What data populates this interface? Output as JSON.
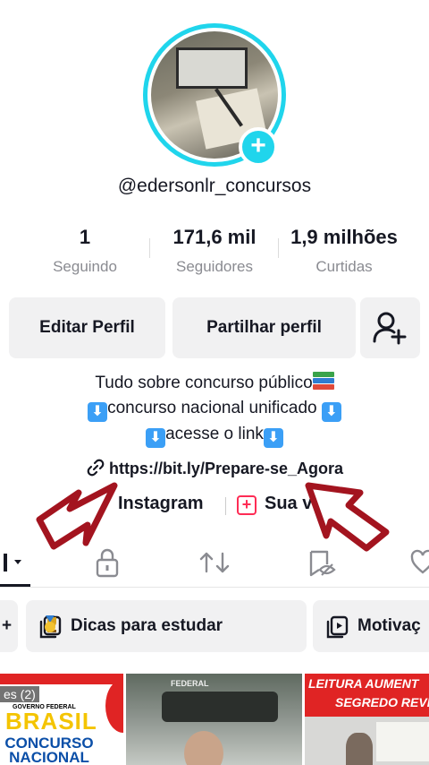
{
  "profile": {
    "username": "@edersonlr_concursos"
  },
  "stats": [
    {
      "value": "1",
      "label": "Seguindo"
    },
    {
      "value": "171,6 mil",
      "label": "Seguidores"
    },
    {
      "value": "1,9 milhões",
      "label": "Curtidas"
    }
  ],
  "actions": {
    "edit_label": "Editar Perfil",
    "share_label": "Partilhar perfil"
  },
  "bio": {
    "line1": "Tudo sobre concurso público",
    "line2": "concurso nacional unificado",
    "line3": "acesse o link",
    "link": "https://bit.ly/Prepare-se_Agora"
  },
  "social": {
    "instagram": "Instagram",
    "sua": "Sua v"
  },
  "playlists": [
    {
      "label": "Dicas para estudar"
    },
    {
      "label": "Motivaç"
    }
  ],
  "thumbnails": {
    "t1_label": "es (2)",
    "t1_brasil": "BRASIL",
    "t1_gov": "GOVERNO FEDERAL",
    "t1_concurso": "CONCURSO NACIONAL UNIFICADO",
    "t2_text": "FEDERAL",
    "t3_line1": "LEITURA AUMENT",
    "t3_line2": "SEGREDO REVEL"
  },
  "colors": {
    "accent": "#20d5ec",
    "brand_red": "#fe2c55",
    "annotation_arrow": "#a3141f"
  }
}
